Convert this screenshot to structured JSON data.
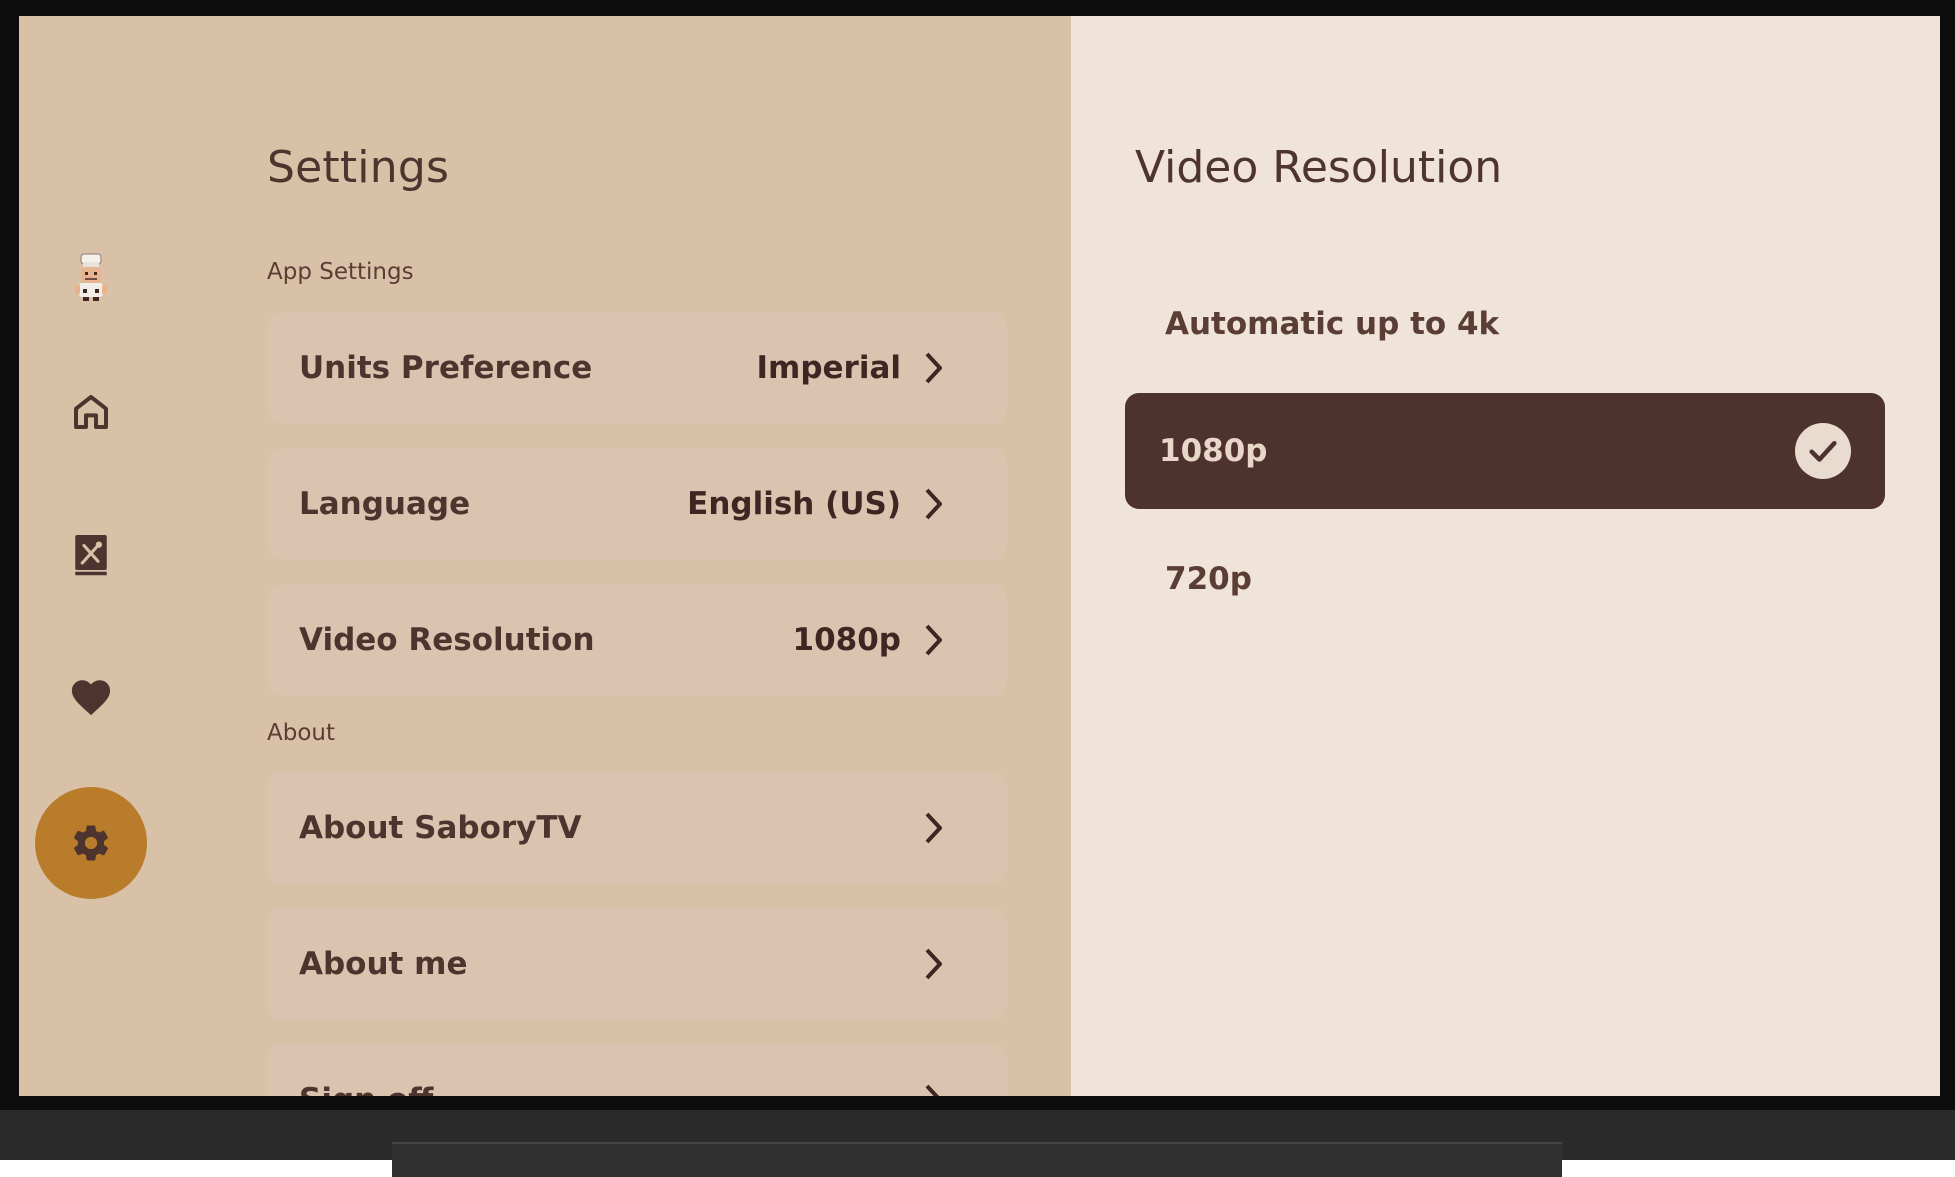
{
  "nav": {
    "items": [
      {
        "name": "profile",
        "icon": "chef-avatar-icon"
      },
      {
        "name": "home",
        "icon": "home-icon"
      },
      {
        "name": "recipes",
        "icon": "recipe-book-icon"
      },
      {
        "name": "favorites",
        "icon": "heart-icon"
      },
      {
        "name": "settings",
        "icon": "gear-icon",
        "active": true
      }
    ]
  },
  "settings": {
    "title": "Settings",
    "app_section": "App Settings",
    "about_section": "About",
    "rows": [
      {
        "label": "Units Preference",
        "value": "Imperial"
      },
      {
        "label": "Language",
        "value": "English (US)"
      },
      {
        "label": "Video Resolution",
        "value": "1080p"
      },
      {
        "label": "About SaboryTV",
        "value": ""
      },
      {
        "label": "About me",
        "value": ""
      },
      {
        "label": "Sign off",
        "value": ""
      }
    ]
  },
  "detail": {
    "title": "Video Resolution",
    "options": [
      {
        "label": "Automatic up to 4k",
        "selected": false
      },
      {
        "label": "1080p",
        "selected": true
      },
      {
        "label": "720p",
        "selected": false
      }
    ]
  },
  "colors": {
    "settings_bg": "#d9c1a8",
    "detail_bg": "#f0e4d8",
    "row_bg": "#dcc3b0",
    "selected_bg": "#4e322d",
    "accent": "#b87c2a",
    "text_dark": "#4e342e"
  }
}
